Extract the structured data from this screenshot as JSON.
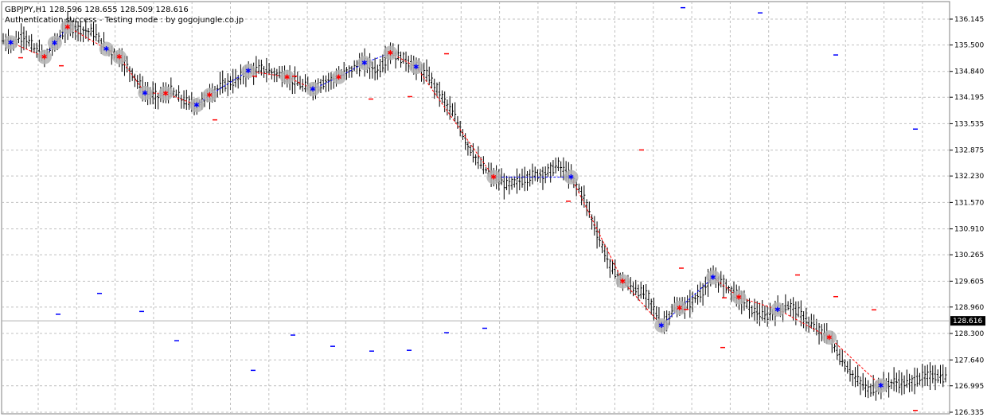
{
  "header": {
    "symbol_line": "GBPJPY,H1  128.596 128.655 128.509 128.616",
    "status_line": "Authentication success - Testing mode : by gogojungle.co.jp"
  },
  "colors": {
    "background": "#ffffff",
    "grid": "#c0c0c0",
    "bars": "#000000",
    "blue_marker": "#0000ff",
    "red_marker": "#ff0000",
    "highlight": "#b4b4b4",
    "current_price_bg": "#000000"
  },
  "chart_data": {
    "type": "ohlc",
    "symbol": "GBPJPY",
    "timeframe": "H1",
    "current_price": 128.616,
    "current_price_label": "128.616",
    "ylim": [
      126.335,
      136.3
    ],
    "grid": true,
    "yticks": [
      "136.145",
      "135.500",
      "134.840",
      "134.195",
      "133.535",
      "132.875",
      "132.230",
      "131.570",
      "130.910",
      "130.265",
      "129.605",
      "128.960",
      "128.300",
      "127.640",
      "126.995",
      "126.335"
    ],
    "ytick_values": [
      136.145,
      135.5,
      134.84,
      134.195,
      133.535,
      132.875,
      132.23,
      131.57,
      130.91,
      130.265,
      129.605,
      128.96,
      128.3,
      127.64,
      126.995,
      126.335
    ],
    "close_path": [
      [
        0,
        135.6
      ],
      [
        4,
        135.55
      ],
      [
        8,
        135.75
      ],
      [
        12,
        135.4
      ],
      [
        16,
        135.2
      ],
      [
        20,
        135.55
      ],
      [
        25,
        135.95
      ],
      [
        30,
        135.9
      ],
      [
        35,
        135.8
      ],
      [
        40,
        135.4
      ],
      [
        45,
        135.2
      ],
      [
        50,
        134.8
      ],
      [
        55,
        134.3
      ],
      [
        60,
        134.2
      ],
      [
        65,
        134.35
      ],
      [
        70,
        134.1
      ],
      [
        75,
        134.0
      ],
      [
        80,
        134.25
      ],
      [
        85,
        134.5
      ],
      [
        90,
        134.6
      ],
      [
        95,
        134.85
      ],
      [
        100,
        134.9
      ],
      [
        105,
        134.8
      ],
      [
        110,
        134.7
      ],
      [
        115,
        134.5
      ],
      [
        120,
        134.4
      ],
      [
        125,
        134.6
      ],
      [
        130,
        134.7
      ],
      [
        135,
        134.9
      ],
      [
        140,
        135.05
      ],
      [
        145,
        134.85
      ],
      [
        150,
        135.3
      ],
      [
        155,
        135.15
      ],
      [
        160,
        134.95
      ],
      [
        165,
        134.7
      ],
      [
        170,
        134.2
      ],
      [
        175,
        133.7
      ],
      [
        180,
        133.0
      ],
      [
        185,
        132.5
      ],
      [
        190,
        132.2
      ],
      [
        195,
        132.0
      ],
      [
        200,
        132.1
      ],
      [
        205,
        132.25
      ],
      [
        210,
        132.3
      ],
      [
        215,
        132.5
      ],
      [
        220,
        132.2
      ],
      [
        225,
        131.7
      ],
      [
        230,
        130.8
      ],
      [
        235,
        130.0
      ],
      [
        240,
        129.6
      ],
      [
        245,
        129.4
      ],
      [
        250,
        129.2
      ],
      [
        255,
        128.5
      ],
      [
        260,
        128.9
      ],
      [
        265,
        129.0
      ],
      [
        270,
        129.3
      ],
      [
        275,
        129.7
      ],
      [
        280,
        129.5
      ],
      [
        285,
        129.2
      ],
      [
        290,
        128.9
      ],
      [
        295,
        128.7
      ],
      [
        300,
        128.9
      ],
      [
        305,
        129.0
      ],
      [
        310,
        128.7
      ],
      [
        315,
        128.4
      ],
      [
        320,
        128.2
      ],
      [
        325,
        127.6
      ],
      [
        330,
        127.2
      ],
      [
        335,
        126.9
      ],
      [
        340,
        127.0
      ],
      [
        345,
        127.1
      ],
      [
        350,
        127.05
      ],
      [
        355,
        127.2
      ],
      [
        360,
        127.25
      ],
      [
        365,
        127.2
      ]
    ],
    "blue_dash_markers": [
      [
        1050,
        135.25
      ],
      [
        955,
        136.3
      ],
      [
        858,
        136.43
      ],
      [
        1150,
        133.4
      ],
      [
        125,
        129.3
      ],
      [
        178,
        128.85
      ],
      [
        73,
        128.78
      ],
      [
        222,
        128.12
      ],
      [
        318,
        127.38
      ],
      [
        368,
        128.26
      ],
      [
        418,
        127.98
      ],
      [
        467,
        127.86
      ],
      [
        514,
        127.88
      ],
      [
        561,
        128.32
      ],
      [
        609,
        128.43
      ]
    ],
    "red_dash_markers": [
      [
        26,
        135.18
      ],
      [
        77,
        134.98
      ],
      [
        270,
        133.63
      ],
      [
        320,
        134.72
      ],
      [
        370,
        134.72
      ],
      [
        466,
        134.15
      ],
      [
        515,
        134.21
      ],
      [
        561,
        135.28
      ],
      [
        714,
        131.6
      ],
      [
        806,
        132.88
      ],
      [
        856,
        129.93
      ],
      [
        862,
        128.9
      ],
      [
        910,
        129.19
      ],
      [
        908,
        127.95
      ],
      [
        1002,
        129.76
      ],
      [
        1050,
        129.22
      ],
      [
        1098,
        128.89
      ],
      [
        1150,
        126.38
      ]
    ]
  }
}
